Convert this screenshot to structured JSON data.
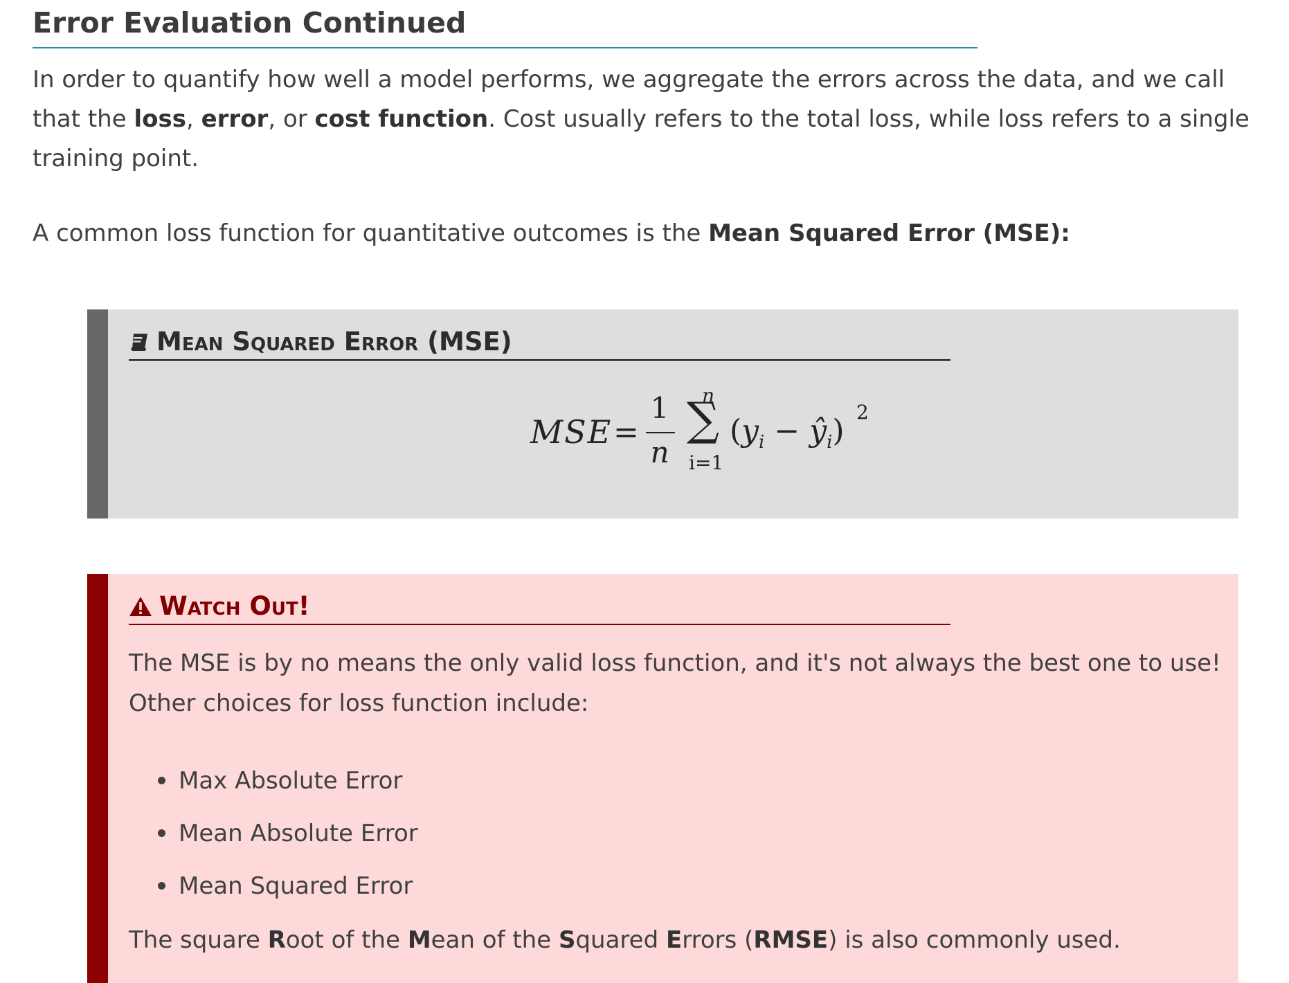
{
  "heading": "Error Evaluation Continued",
  "para1": {
    "t1": "In order to quantify how well a model performs, we aggregate the errors across the data, and we call that the ",
    "b1": "loss",
    "t2": ", ",
    "b2": "error",
    "t3": ", or ",
    "b3": "cost function",
    "t4": ". Cost usually refers to the total loss, while loss refers to a single training point."
  },
  "para2": {
    "t1": "A common loss function for quantitative outcomes is the ",
    "b1": "Mean Squared Error (MSE):"
  },
  "definition": {
    "icon": "book-icon",
    "title": "Mean Squared Error (MSE)",
    "formula": {
      "lhs": "MSE",
      "equals": "=",
      "numerator": "1",
      "denominator": "n",
      "sum_upper": "n",
      "sum_symbol": "∑",
      "sum_lower": "i=1",
      "open": "(",
      "y": "y",
      "y_sub": "i",
      "minus": " − ",
      "yhat": "ŷ",
      "yhat_sub": "i",
      "close": ")",
      "power": "2"
    }
  },
  "warning": {
    "icon": "warning-triangle-icon",
    "title": "Watch Out!",
    "body": "The MSE is by no means the only valid loss function, and it's not always the best one to use! Other choices for loss function include:",
    "items": [
      "Max Absolute Error",
      "Mean Absolute Error",
      "Mean Squared Error"
    ],
    "rmse": {
      "t1": "The square ",
      "b1": "R",
      "t2": "oot of the ",
      "b2": "M",
      "t3": "ean of the ",
      "b3": "S",
      "t4": "quared ",
      "b4": "E",
      "t5": "rrors (",
      "b5": "RMSE",
      "t6": ") is also commonly used."
    }
  }
}
